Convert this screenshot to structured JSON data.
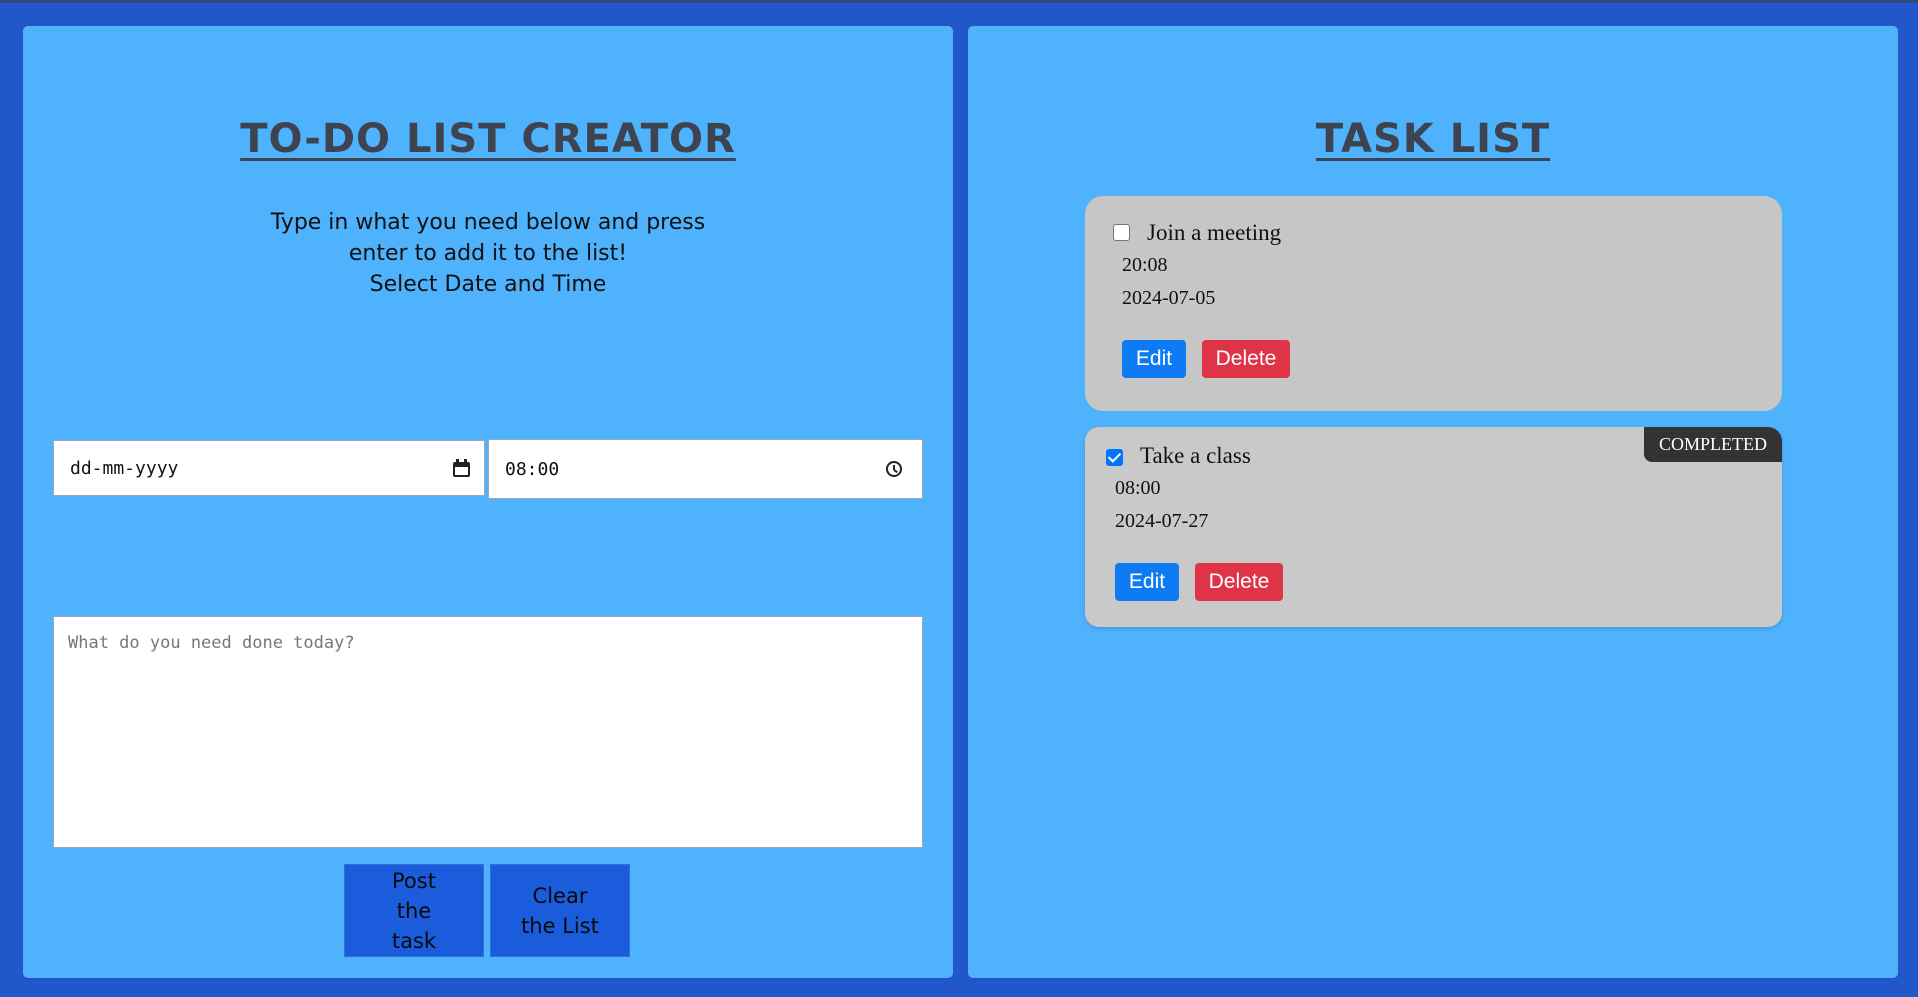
{
  "colors": {
    "page_background": "#2257c9",
    "panel_background": "#4fb2fd",
    "title_color": "#3d4450",
    "action_button": "#1a5cdc",
    "card_background": "#c6c6c6",
    "edit_button": "#0d7bf4",
    "delete_button": "#df3348",
    "completed_badge": "#333333"
  },
  "creator": {
    "title": "To-Do List Creator",
    "instructions": [
      "Type in what you need below and press",
      "enter to add it to the list!",
      "Select Date and Time"
    ],
    "date_input": {
      "value": "dd-mm-yyyy",
      "icon": "calendar-icon"
    },
    "time_input": {
      "value": "08:00",
      "icon": "clock-icon"
    },
    "task_input": {
      "placeholder": "What do you need done today?",
      "value": ""
    },
    "post_button": "Post the task",
    "clear_button": "Clear the List"
  },
  "task_list": {
    "title": "Task List",
    "tasks": [
      {
        "name": "Join a meeting",
        "time": "20:08",
        "date": "2024-07-05",
        "completed": false,
        "edit_label": "Edit",
        "delete_label": "Delete"
      },
      {
        "name": "Take a class",
        "time": "08:00",
        "date": "2024-07-27",
        "completed": true,
        "badge": "COMPLETED",
        "edit_label": "Edit",
        "delete_label": "Delete"
      }
    ]
  }
}
